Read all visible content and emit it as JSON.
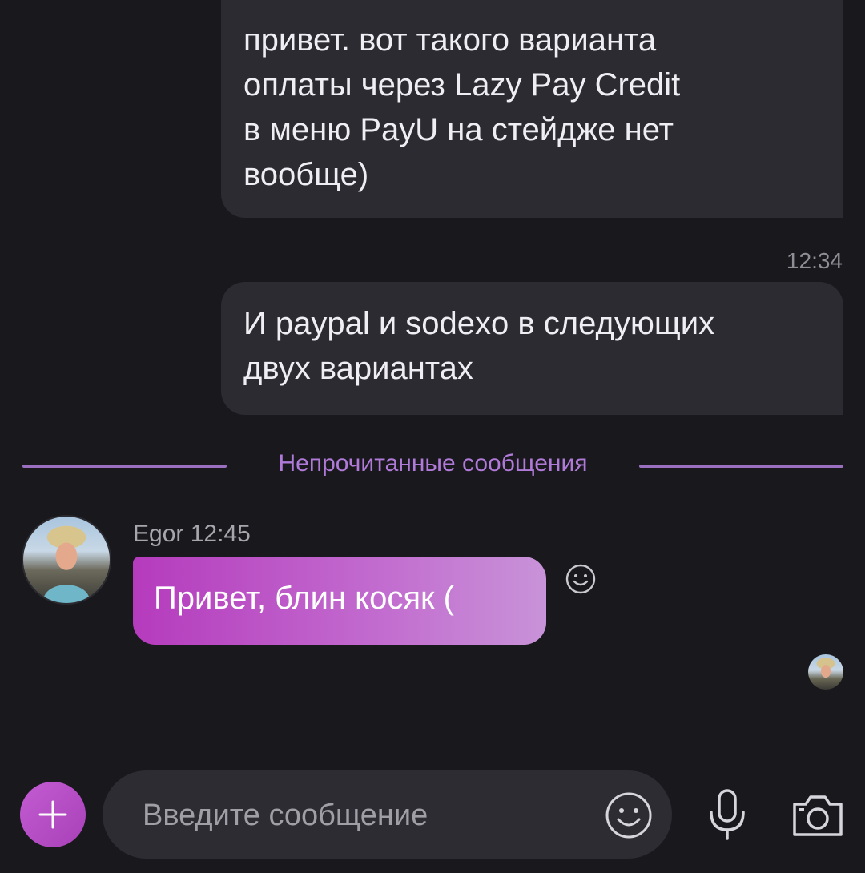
{
  "messages_out": [
    {
      "lines": [
        "привет. вот такого варианта",
        "оплаты через Lazy Pay Credit",
        "в меню PayU на стейдже нет",
        "вообще)"
      ]
    },
    {
      "lines": [
        "И paypal и sodexo в следующих",
        "двух вариантах"
      ],
      "time": "12:34"
    }
  ],
  "divider": {
    "label": "Непрочитанные сообщения"
  },
  "incoming": {
    "sender": "Egor",
    "time": "12:45",
    "text": "Привет, блин косяк ("
  },
  "composer": {
    "placeholder": "Введите сообщение"
  },
  "colors": {
    "background": "#19181d",
    "bubble_out": "#2c2b32",
    "accent": "#b53bbd",
    "divider": "#9a6fc0"
  },
  "icons": {
    "react": "smile-icon",
    "add": "plus-icon",
    "emoji": "emoji-icon",
    "mic": "microphone-icon",
    "camera": "camera-icon"
  }
}
